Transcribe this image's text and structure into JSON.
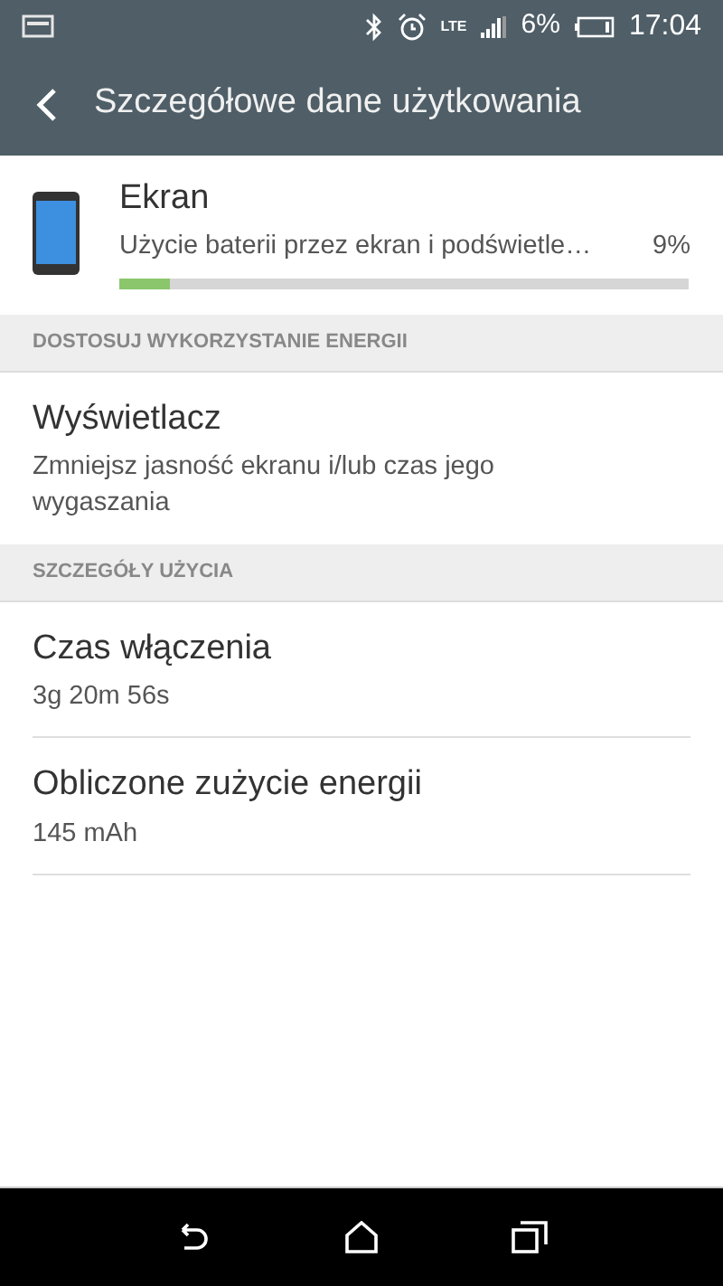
{
  "status_bar": {
    "network": "LTE",
    "battery": "6%",
    "time": "17:04"
  },
  "app_bar": {
    "title": "Szczegółowe dane użytkowania"
  },
  "app_item": {
    "title": "Ekran",
    "subtitle": "Użycie baterii przez ekran i podświetle…",
    "percent": "9%",
    "level": 0.09
  },
  "sections": [
    {
      "header": "DOSTOSUJ WYKORZYSTANIE ENERGII",
      "items": [
        {
          "title": "Wyświetlacz",
          "subtitle": "Zmniejsz jasność ekranu i/lub czas jego wygaszania"
        }
      ]
    },
    {
      "header": "SZCZEGÓŁY UŻYCIA",
      "items": [
        {
          "title": "Czas włączenia",
          "subtitle": "3g 20m 56s"
        },
        {
          "title": "Obliczone zużycie energii",
          "subtitle": "145 mAh"
        }
      ]
    }
  ]
}
